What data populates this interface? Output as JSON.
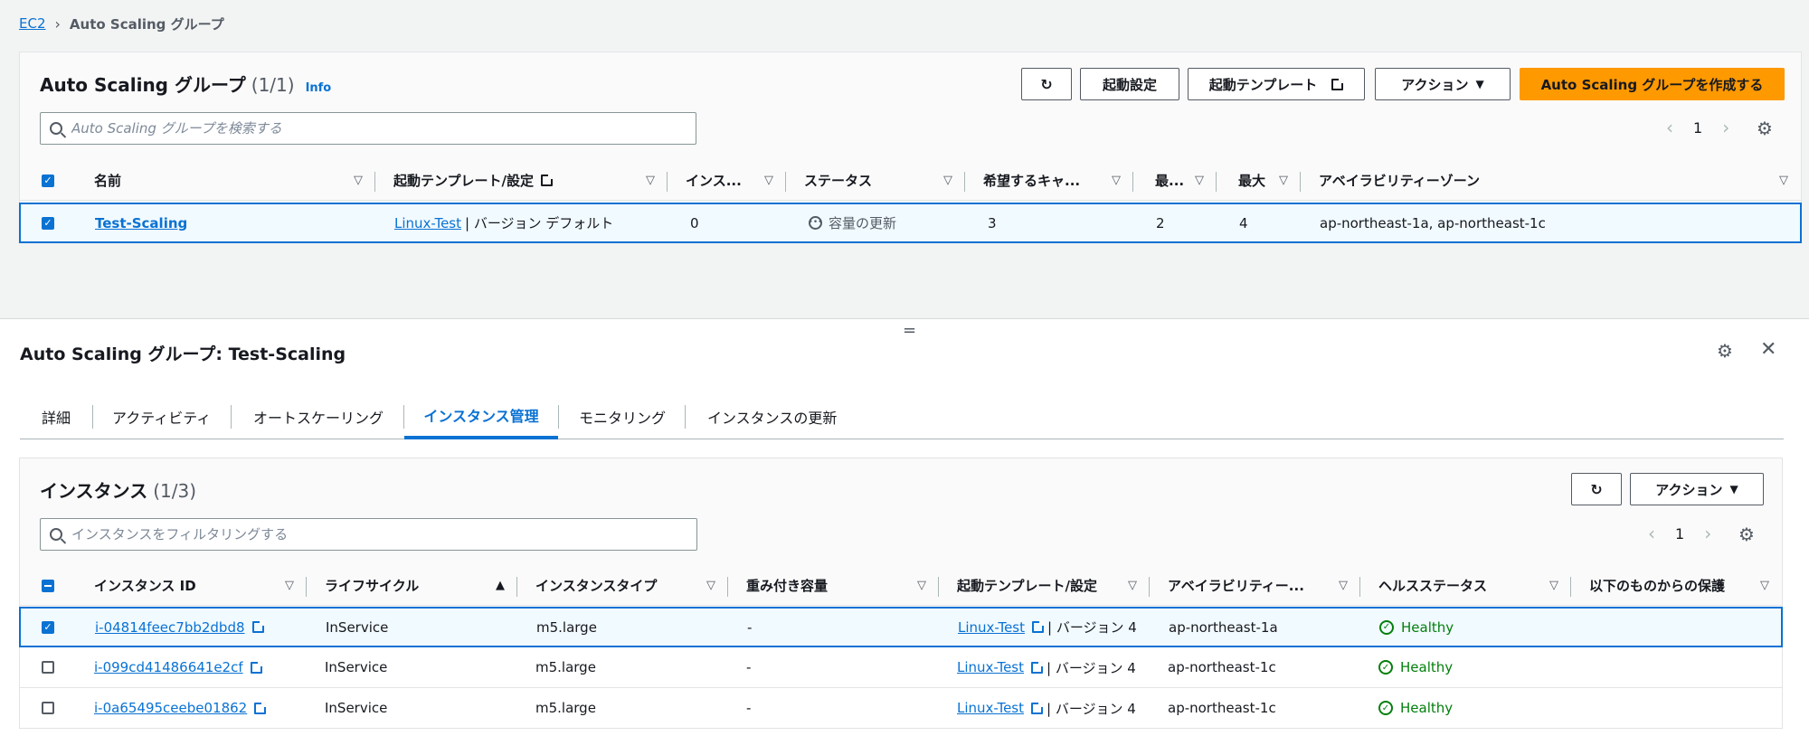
{
  "breadcrumb": {
    "root": "EC2",
    "current": "Auto Scaling グループ"
  },
  "top_panel": {
    "title": "Auto Scaling グループ",
    "count": "(1/1)",
    "info": "Info",
    "buttons": {
      "launch_config": "起動設定",
      "launch_template": "起動テンプレート",
      "actions": "アクション",
      "create": "Auto Scaling グループを作成する"
    },
    "search_placeholder": "Auto Scaling グループを検索する",
    "page": "1",
    "columns": [
      "名前",
      "起動テンプレート/設定",
      "インス...",
      "ステータス",
      "希望するキャ...",
      "最...",
      "最大",
      "アベイラビリティーゾーン"
    ],
    "row": {
      "name": "Test-Scaling",
      "template": "Linux-Test",
      "template_suffix": "| バージョン デフォルト",
      "instances": "0",
      "status": "容量の更新",
      "desired": "3",
      "min": "2",
      "max": "4",
      "az": "ap-northeast-1a, ap-northeast-1c"
    }
  },
  "detail": {
    "title": "Auto Scaling グループ: Test-Scaling",
    "tabs": [
      "詳細",
      "アクティビティ",
      "オートスケーリング",
      "インスタンス管理",
      "モニタリング",
      "インスタンスの更新"
    ],
    "active_tab": "インスタンス管理"
  },
  "instances_panel": {
    "title": "インスタンス",
    "count": "(1/3)",
    "actions": "アクション",
    "search_placeholder": "インスタンスをフィルタリングする",
    "page": "1",
    "columns": [
      "インスタンス ID",
      "ライフサイクル",
      "インスタンスタイプ",
      "重み付き容量",
      "起動テンプレート/設定",
      "アベイラビリティー...",
      "ヘルスステータス",
      "以下のものからの保護"
    ],
    "rows": [
      {
        "id": "i-04814feec7bb2dbd8",
        "lifecycle": "InService",
        "type": "m5.large",
        "weight": "-",
        "template": "Linux-Test",
        "version": "| バージョン 4",
        "az": "ap-northeast-1a",
        "health": "Healthy",
        "selected": true
      },
      {
        "id": "i-099cd41486641e2cf",
        "lifecycle": "InService",
        "type": "m5.large",
        "weight": "-",
        "template": "Linux-Test",
        "version": "| バージョン 4",
        "az": "ap-northeast-1c",
        "health": "Healthy",
        "selected": false
      },
      {
        "id": "i-0a65495ceebe01862",
        "lifecycle": "InService",
        "type": "m5.large",
        "weight": "-",
        "template": "Linux-Test",
        "version": "| バージョン 4",
        "az": "ap-northeast-1c",
        "health": "Healthy",
        "selected": false
      }
    ]
  },
  "colors": {
    "accent": "#0972d3",
    "primary_button": "#ff9900",
    "healthy": "#037f0c"
  }
}
